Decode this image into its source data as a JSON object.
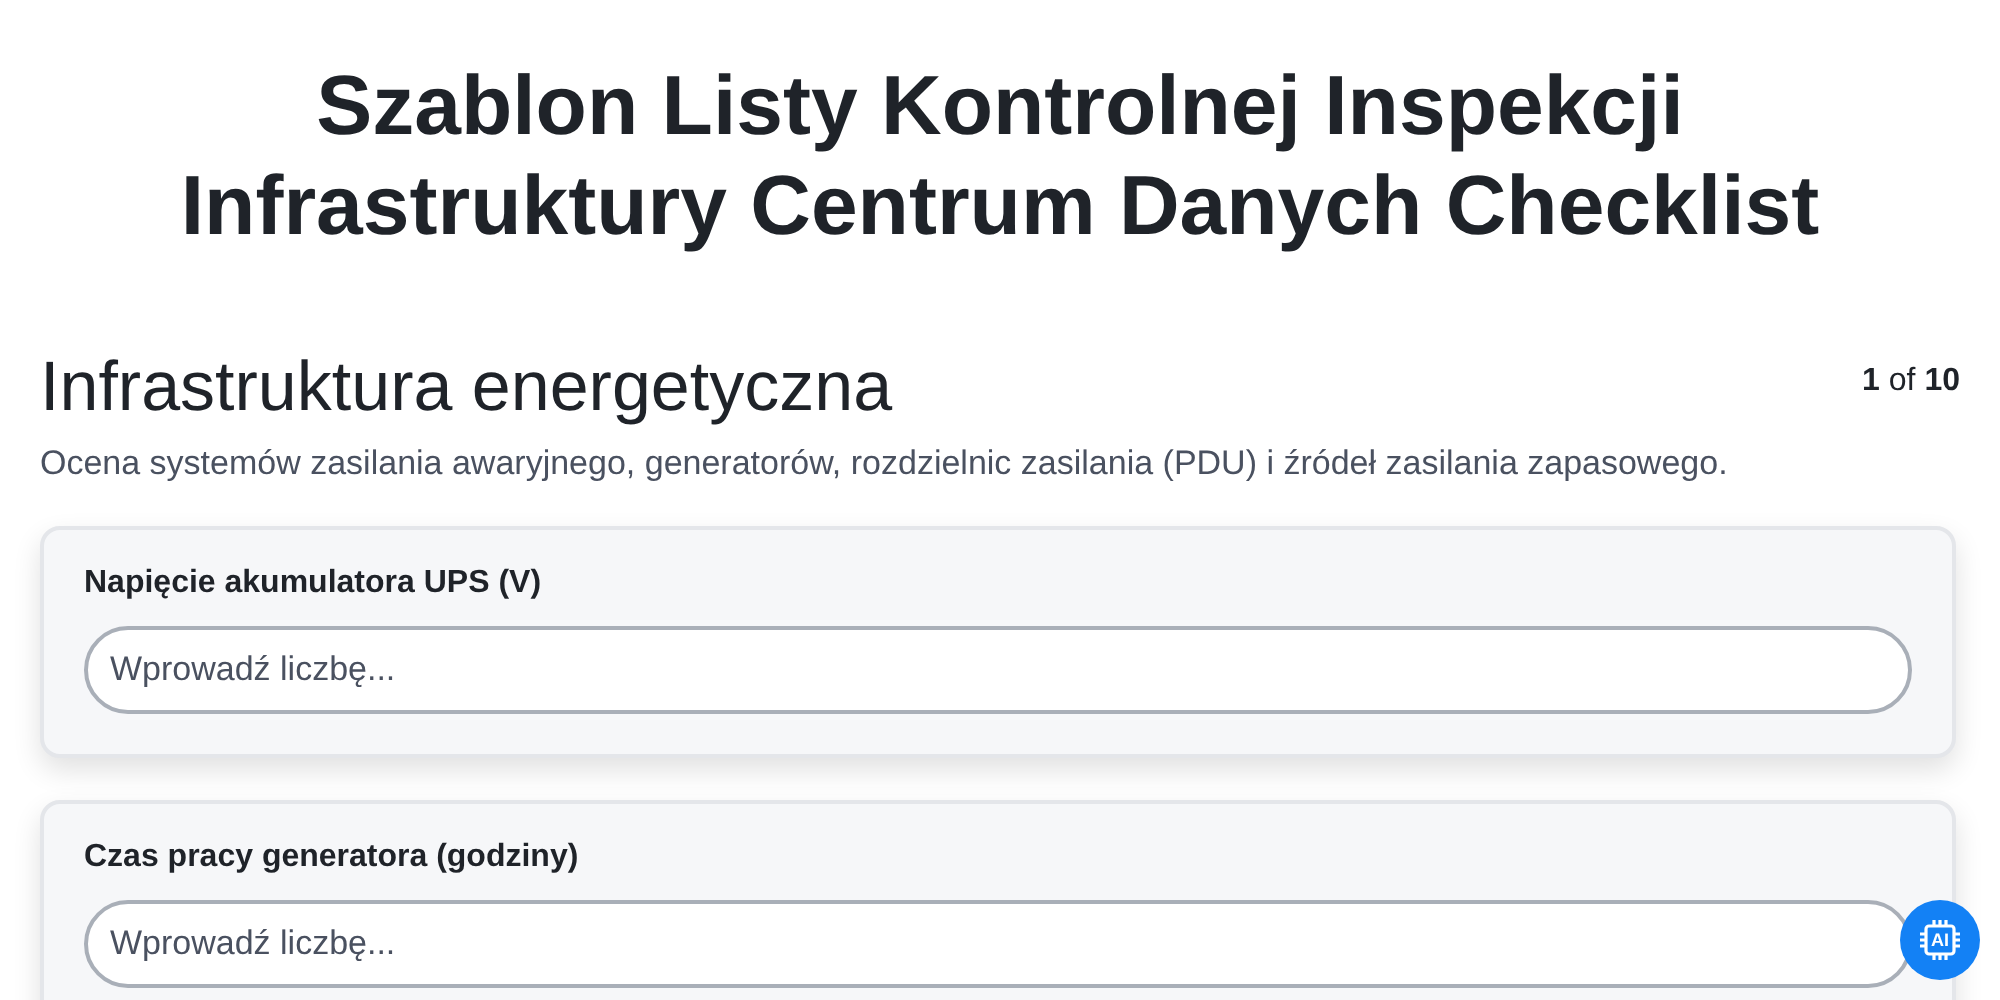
{
  "title": "Szablon Listy Kontrolnej Inspekcji Infrastruktury Centrum Danych Checklist",
  "section": {
    "heading": "Infrastruktura energetyczna",
    "page_current": "1",
    "page_of": "of",
    "page_total": "10",
    "description": "Ocena systemów zasilania awaryjnego, generatorów, rozdzielnic zasilania (PDU) i źródeł zasilania zapasowego."
  },
  "questions": [
    {
      "label": "Napięcie akumulatora UPS (V)",
      "placeholder": "Wprowadź liczbę..."
    },
    {
      "label": "Czas pracy generatora (godziny)",
      "placeholder": "Wprowadź liczbę..."
    }
  ],
  "ai_button": {
    "label": "AI"
  }
}
